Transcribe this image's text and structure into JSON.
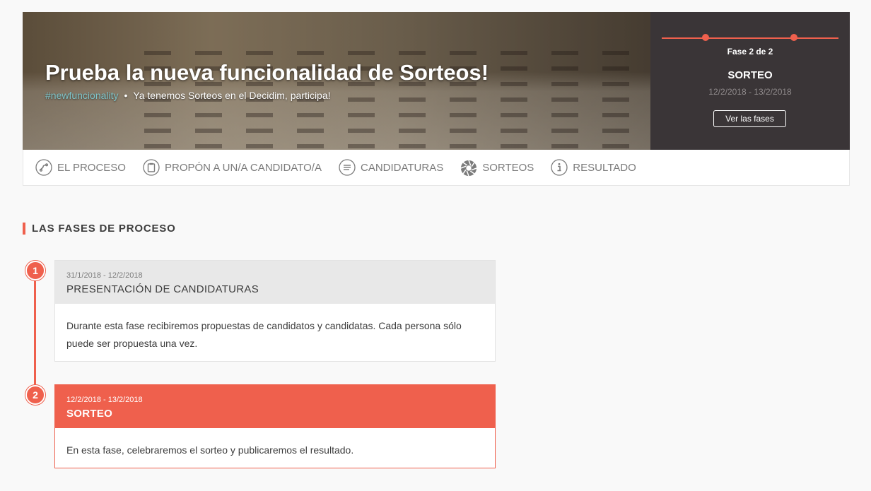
{
  "hero": {
    "title": "Prueba la nueva funcionalidad de Sorteos!",
    "hashtag": "#newfuncionality",
    "dot": "•",
    "subtitle": "Ya tenemos Sorteos en el Decidim, participa!"
  },
  "phase_box": {
    "count": "Fase 2 de 2",
    "name": "SORTEO",
    "dates": "12/2/2018 - 13/2/2018",
    "button": "Ver las fases"
  },
  "nav": {
    "items": [
      {
        "label": "El proceso",
        "icon": "process-icon"
      },
      {
        "label": "Propón a un/a candidato/a",
        "icon": "clipboard-icon"
      },
      {
        "label": "Candidaturas",
        "icon": "list-icon"
      },
      {
        "label": "Sorteos",
        "icon": "shutter-icon"
      },
      {
        "label": "Resultado",
        "icon": "info-icon"
      }
    ]
  },
  "section": {
    "title": "Las fases de proceso"
  },
  "phases": [
    {
      "number": "1",
      "dates": "31/1/2018 - 12/2/2018",
      "title": "PRESENTACIÓN DE CANDIDATURAS",
      "description": "Durante esta fase recibiremos propuestas de candidatos y candidatas. Cada persona sólo puede ser propuesta una vez."
    },
    {
      "number": "2",
      "dates": "12/2/2018 - 13/2/2018",
      "title": "SORTEO",
      "description": "En esta fase, celebraremos el sorteo y publicaremos el resultado."
    }
  ],
  "colors": {
    "accent": "#ef604d",
    "phase_box_bg": "#3a3537",
    "hashtag": "#7fc4c9"
  }
}
